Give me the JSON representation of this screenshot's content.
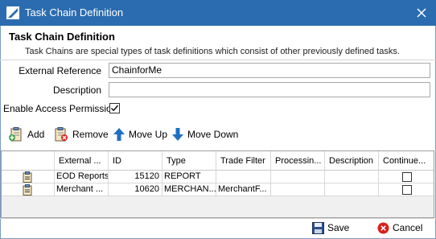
{
  "window": {
    "title": "Task Chain Definition"
  },
  "header": {
    "title": "Task Chain Definition",
    "description": "Task Chains are special types of task definitions which consist of other previously defined tasks."
  },
  "form": {
    "external_reference_label": "External Reference",
    "external_reference_value": "ChainforMe",
    "description_label": "Description",
    "description_value": "",
    "enable_access_permission_label": "Enable Access Permission",
    "enable_access_permission_checked": true
  },
  "toolbar": {
    "add_label": "Add",
    "remove_label": "Remove",
    "move_up_label": "Move Up",
    "move_down_label": "Move Down"
  },
  "grid": {
    "columns": [
      "External ...",
      "ID",
      "Type",
      "Trade Filter",
      "Processin...",
      "Description",
      "Continue..."
    ],
    "rows": [
      {
        "external": "EOD Reports",
        "id": "15120",
        "type": "REPORT",
        "trade_filter": "",
        "processing": "",
        "description": "",
        "continue": false
      },
      {
        "external": "Merchant ...",
        "id": "10620",
        "type": "MERCHAN...",
        "trade_filter": "MerchantF...",
        "processing": "",
        "description": "",
        "continue": false
      }
    ]
  },
  "footer": {
    "save_label": "Save",
    "cancel_label": "Cancel"
  },
  "colors": {
    "titlebar": "#2b6cb0",
    "cancel_red": "#d9211c",
    "arrow_blue": "#1f6fc5"
  }
}
